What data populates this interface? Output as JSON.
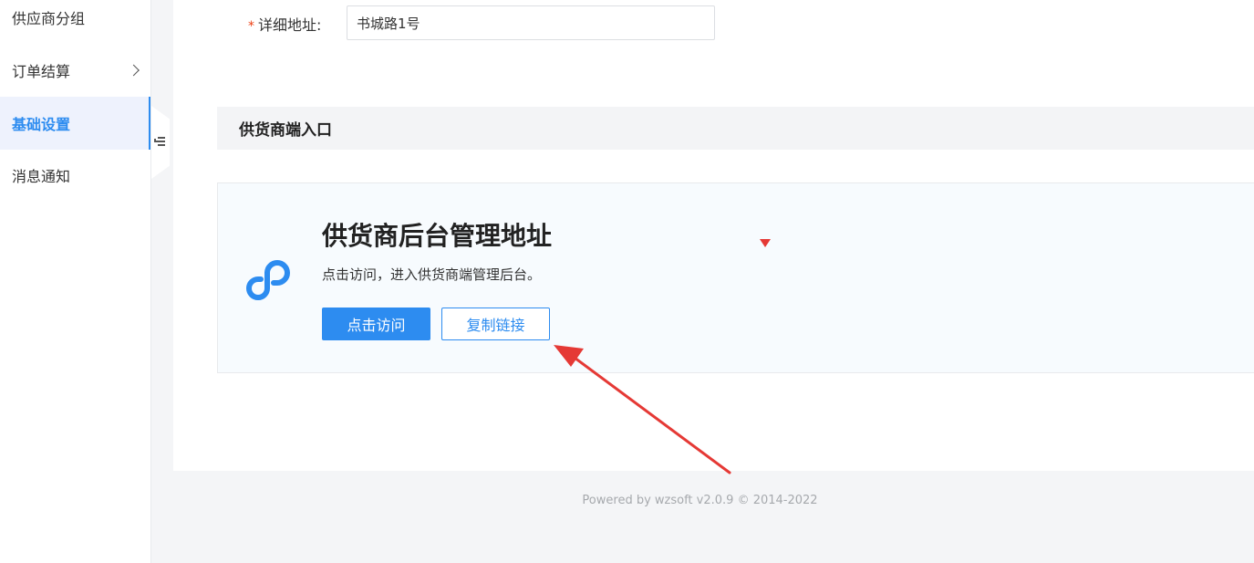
{
  "sidebar": {
    "items": [
      {
        "label": "供应商分组",
        "active": false,
        "has_submenu": false
      },
      {
        "label": "订单结算",
        "active": false,
        "has_submenu": true
      },
      {
        "label": "基础设置",
        "active": true,
        "has_submenu": false
      },
      {
        "label": "消息通知",
        "active": false,
        "has_submenu": false
      }
    ],
    "collapse_icon": "menu-fold-icon"
  },
  "form": {
    "address": {
      "required_mark": "*",
      "label": "详细地址:",
      "value": "书城路1号"
    }
  },
  "section": {
    "title": "供货商端入口"
  },
  "card": {
    "icon": "link-icon",
    "title": "供货商后台管理地址",
    "description": "点击访问，进入供货商端管理后台。",
    "visit_button": "点击访问",
    "copy_button": "复制链接"
  },
  "footer": {
    "text": "Powered by wzsoft v2.0.9 © 2014-2022"
  },
  "colors": {
    "accent": "#2d8cf0",
    "required": "#ed4014",
    "annotation": "#e53935",
    "active_bg": "#eef2fd"
  }
}
